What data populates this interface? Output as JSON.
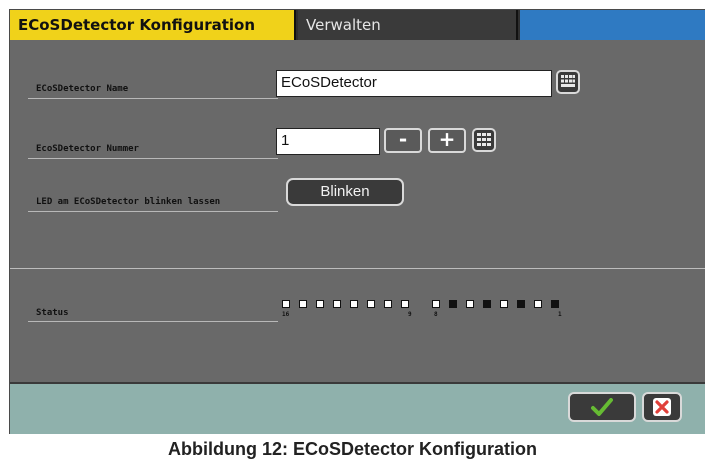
{
  "tabs": [
    {
      "label": "ECoSDetector Konfiguration"
    },
    {
      "label": "Verwalten"
    }
  ],
  "form": {
    "name_label": "ECoSDetector Name",
    "name_value": "ECoSDetector",
    "number_label": "EcoSDetector Nummer",
    "number_value": "1",
    "minus_label": "-",
    "plus_label": "+",
    "led_label": "LED am ECoSDetector blinken lassen",
    "blink_label": "Blinken"
  },
  "status": {
    "label": "Status",
    "bits": [
      0,
      0,
      0,
      0,
      0,
      0,
      0,
      0,
      0,
      1,
      0,
      1,
      0,
      1,
      0,
      1
    ],
    "bit_numbers": {
      "b16": "16",
      "b9": "9",
      "b8": "8",
      "b1": "1"
    }
  },
  "footer": {
    "ok_icon": "check-icon",
    "cancel_icon": "cross-icon"
  },
  "caption": "Abbildung 12: ECoSDetector Konfiguration",
  "colors": {
    "active_tab": "#f0d21a",
    "tab_accent": "#2f7ac2",
    "panel": "#696969",
    "footer": "#8fb1ac",
    "ok_green": "#66bb33",
    "cancel_red": "#e0403a"
  }
}
